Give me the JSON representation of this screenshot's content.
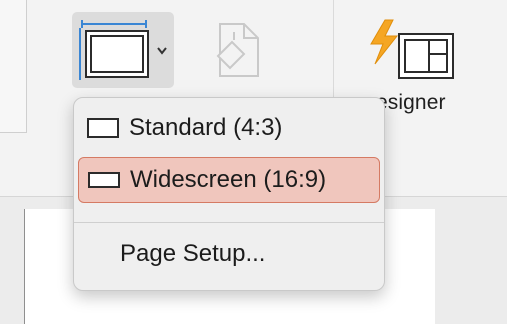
{
  "ribbon": {
    "designer_label": "esigner",
    "colors": {
      "accent": "#3a86d4",
      "designer_bolt": "#f5a623",
      "highlight_bg": "#f0c6bd",
      "highlight_border": "#d57a63"
    }
  },
  "dropdown": {
    "items": [
      {
        "label": "Standard (4:3)",
        "icon": "standard-slide-icon"
      },
      {
        "label": "Widescreen (16:9)",
        "icon": "widescreen-slide-icon",
        "selected": true
      },
      {
        "label": "Page Setup..."
      }
    ]
  }
}
